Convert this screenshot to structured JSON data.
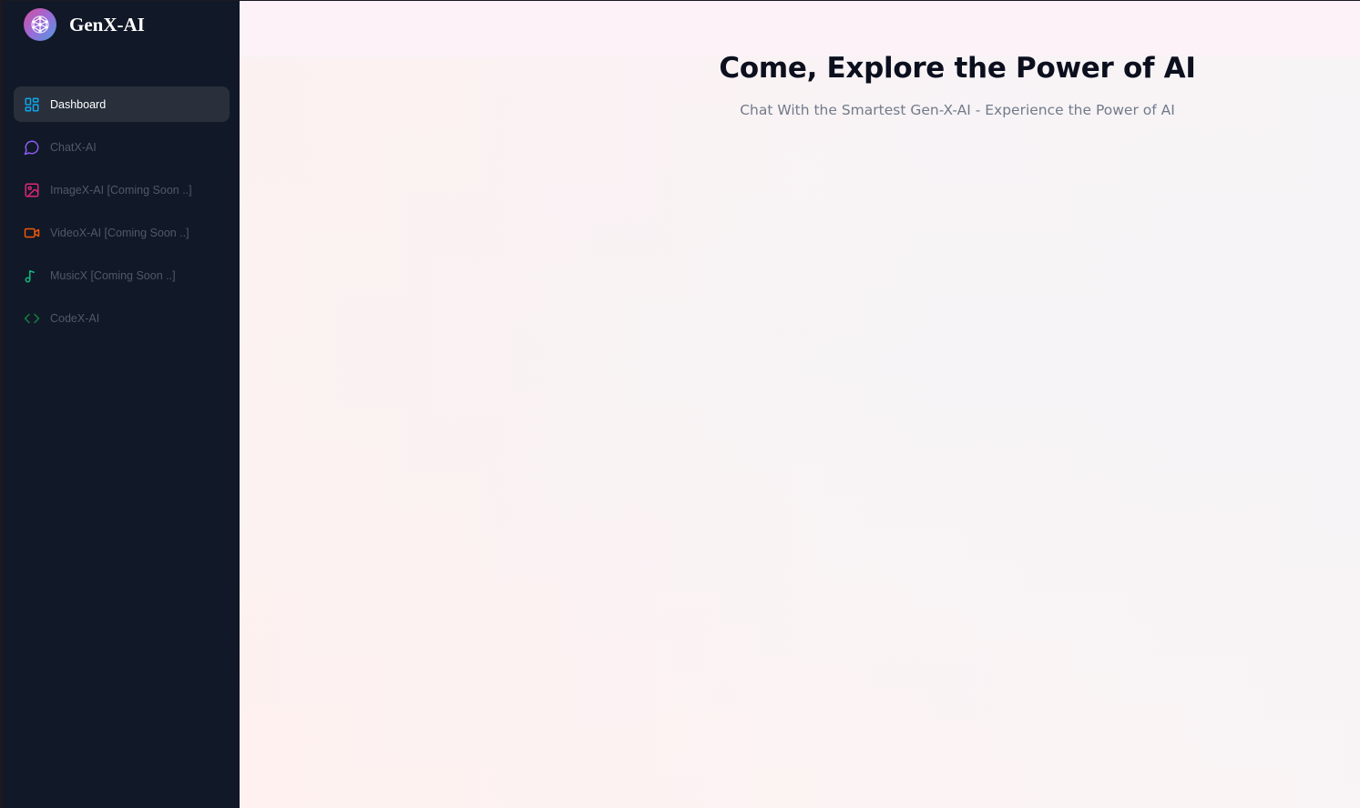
{
  "app": {
    "name": "GenX-AI",
    "logo_icon": "brain-network-icon"
  },
  "sidebar": {
    "items": [
      {
        "label": "Dashboard",
        "icon": "dashboard-grid-icon",
        "color": "#0ea5e9",
        "active": true
      },
      {
        "label": "ChatX-AI",
        "icon": "chat-bubble-icon",
        "color": "#8b5cf6",
        "active": false
      },
      {
        "label": "ImageX-AI [Coming Soon ..]",
        "icon": "image-icon",
        "color": "#db2777",
        "active": false
      },
      {
        "label": "VideoX-AI [Coming Soon ..]",
        "icon": "video-camera-icon",
        "color": "#ea580c",
        "active": false
      },
      {
        "label": "MusicX [Coming Soon ..]",
        "icon": "music-note-icon",
        "color": "#10b981",
        "active": false
      },
      {
        "label": "CodeX-AI",
        "icon": "code-brackets-icon",
        "color": "#15803d",
        "active": false
      }
    ]
  },
  "main": {
    "title": "Come, Explore the Power of AI",
    "subtitle": "Chat With the Smartest Gen-X-AI - Experience the Power of AI"
  },
  "colors": {
    "sidebar_bg": "#111827",
    "active_item_bg": "#29303c",
    "inactive_text": "#50596a",
    "title_text": "#0b0f1e",
    "subtitle_text": "#717b8a"
  }
}
